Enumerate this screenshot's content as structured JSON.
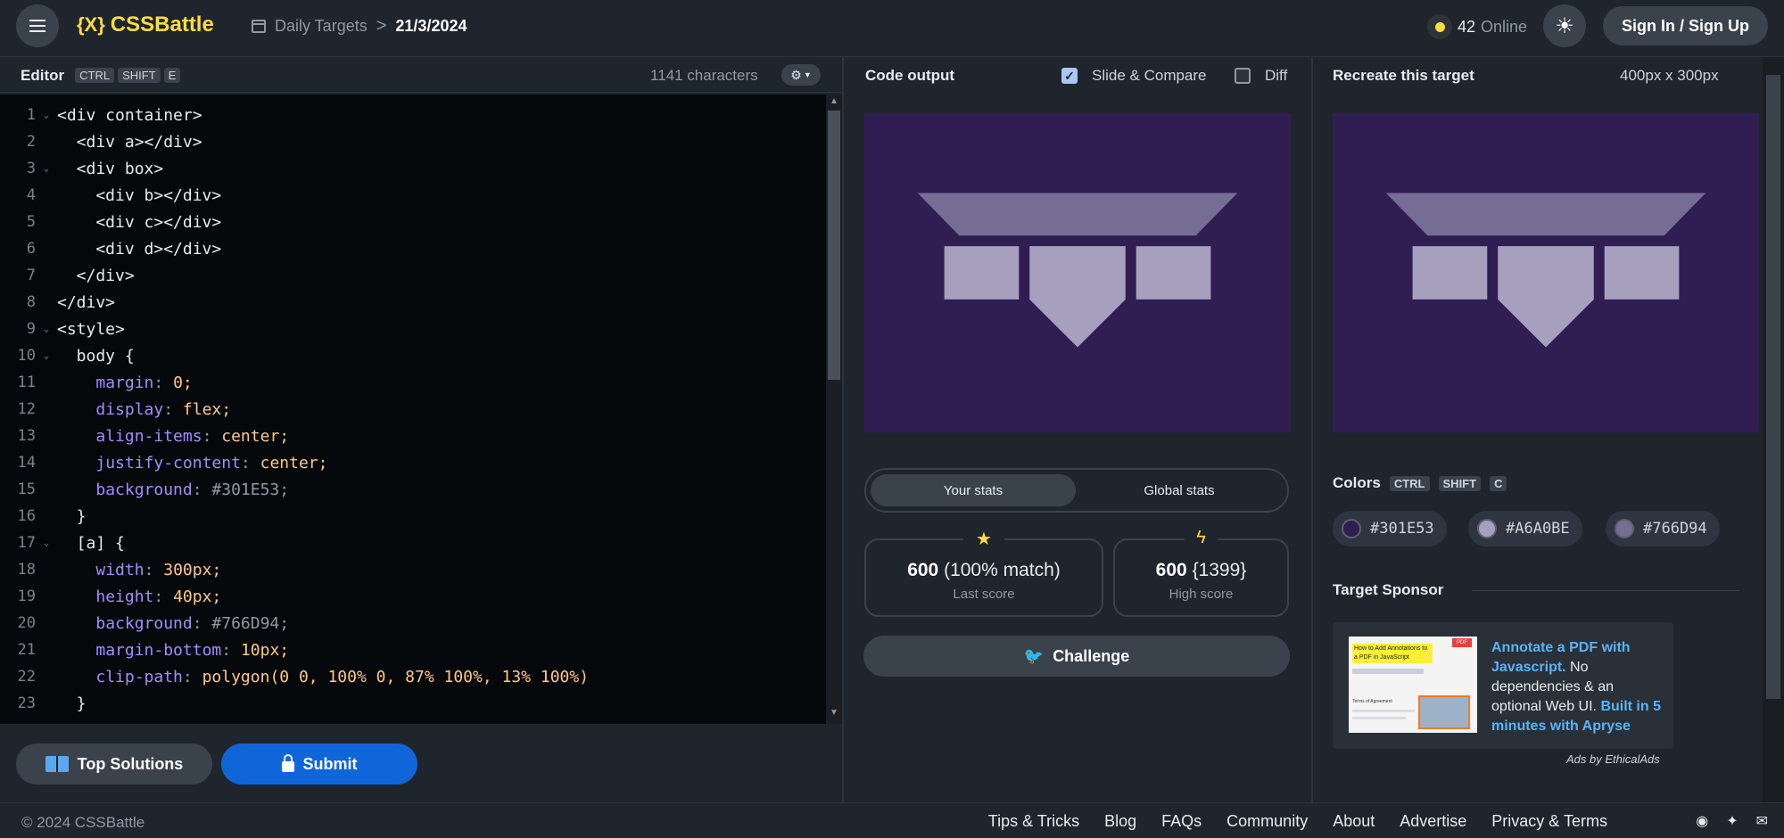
{
  "header": {
    "logo_mark": "{X}",
    "logo_text": "CSSBattle",
    "breadcrumb_section": "Daily Targets",
    "breadcrumb_separator": ">",
    "breadcrumb_date": "21/3/2024",
    "online_count": "42",
    "online_label": "Online",
    "signin_label": "Sign In / Sign Up"
  },
  "editor": {
    "title": "Editor",
    "shortcut": [
      "CTRL",
      "SHIFT",
      "E"
    ],
    "char_count": "1141 characters",
    "lines": [
      {
        "n": "1",
        "fold": "⌄",
        "text": "<div container>"
      },
      {
        "n": "2",
        "fold": "",
        "text": "  <div a></div>"
      },
      {
        "n": "3",
        "fold": "⌄",
        "text": "  <div box>"
      },
      {
        "n": "4",
        "fold": "",
        "text": "    <div b></div>"
      },
      {
        "n": "5",
        "fold": "",
        "text": "    <div c></div>"
      },
      {
        "n": "6",
        "fold": "",
        "text": "    <div d></div>"
      },
      {
        "n": "7",
        "fold": "",
        "text": "  </div>"
      },
      {
        "n": "8",
        "fold": "",
        "text": "</div>"
      },
      {
        "n": "9",
        "fold": "⌄",
        "text": "<style>"
      },
      {
        "n": "10",
        "fold": "⌄",
        "text": "  body {"
      },
      {
        "n": "11",
        "fold": "",
        "text": "    margin: 0;"
      },
      {
        "n": "12",
        "fold": "",
        "text": "    display: flex;"
      },
      {
        "n": "13",
        "fold": "",
        "text": "    align-items: center;"
      },
      {
        "n": "14",
        "fold": "",
        "text": "    justify-content: center;"
      },
      {
        "n": "15",
        "fold": "",
        "text": "    background: #301E53;"
      },
      {
        "n": "16",
        "fold": "",
        "text": "  }"
      },
      {
        "n": "17",
        "fold": "⌄",
        "text": "  [a] {"
      },
      {
        "n": "18",
        "fold": "",
        "text": "    width: 300px;"
      },
      {
        "n": "19",
        "fold": "",
        "text": "    height: 40px;"
      },
      {
        "n": "20",
        "fold": "",
        "text": "    background: #766D94;"
      },
      {
        "n": "21",
        "fold": "",
        "text": "    margin-bottom: 10px;"
      },
      {
        "n": "22",
        "fold": "",
        "text": "    clip-path: polygon(0 0, 100% 0, 87% 100%, 13% 100%)"
      },
      {
        "n": "23",
        "fold": "",
        "text": "  }"
      }
    ],
    "top_solutions_label": "Top Solutions",
    "submit_label": "Submit"
  },
  "output": {
    "title": "Code output",
    "slide_compare_label": "Slide & Compare",
    "slide_compare_checked": true,
    "diff_label": "Diff",
    "diff_checked": false,
    "tab_your_stats": "Your stats",
    "tab_global_stats": "Global stats",
    "last_score_value": "600",
    "last_score_match": "(100% match)",
    "last_score_label": "Last score",
    "high_score_value": "600",
    "high_score_rank": "{1399}",
    "high_score_label": "High score",
    "challenge_label": "Challenge"
  },
  "target": {
    "title": "Recreate this target",
    "size": "400px x 300px",
    "colors_title": "Colors",
    "colors_shortcut": [
      "CTRL",
      "SHIFT",
      "C"
    ],
    "colors": [
      {
        "hex": "#301E53"
      },
      {
        "hex": "#A6A0BE"
      },
      {
        "hex": "#766D94"
      }
    ],
    "sponsor_title": "Target Sponsor",
    "ad_thumb_title": "How to Add Annotations to a PDF in JavaScript",
    "ad_thumb_badge": "PDF",
    "ad_thumb_caption": "Terms of Agreement",
    "ad_link1": "Annotate a PDF with Javascript.",
    "ad_body": " No dependencies & an optional Web UI. ",
    "ad_link2": "Built in 5 minutes with Apryse",
    "ad_footer": "Ads by EthicalAds"
  },
  "footer": {
    "copyright": "© 2024 CSSBattle",
    "links": [
      "Tips & Tricks",
      "Blog",
      "FAQs",
      "Community",
      "About",
      "Advertise",
      "Privacy & Terms"
    ]
  },
  "icons": {
    "menu": "menu-icon",
    "calendar": "calendar-icon",
    "theme": "sun-icon",
    "settings": "gear-icon",
    "book": "book-icon",
    "lock": "lock-icon",
    "star": "star-icon",
    "bolt": "lightning-icon",
    "twitter": "twitter-icon",
    "discord": "discord-icon",
    "mail": "mail-icon"
  },
  "palette": {
    "accent": "#ffdd40",
    "submit": "#1066d8",
    "target_bg": "#301E53",
    "shape_light": "#A6A0BE",
    "shape_dark": "#766D94"
  }
}
